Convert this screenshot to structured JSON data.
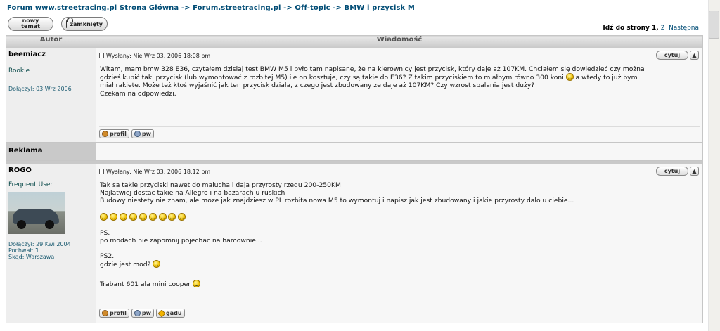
{
  "breadcrumb": "Forum www.streetracing.pl Strona Główna -> Forum.streetracing.pl -> Off-topic -> BMW i przycisk M",
  "buttons": {
    "new_topic_line1": "nowy",
    "new_topic_line2": "temat",
    "locked": "zamknięty"
  },
  "pager": {
    "prefix": "Idź do strony",
    "current": "1",
    "sep": ",",
    "page2": "2",
    "next": "Następna"
  },
  "table": {
    "col_author": "Autor",
    "col_message": "Wiadomość"
  },
  "posts": [
    {
      "author": "beemiacz",
      "rank": "Rookie",
      "joined": "Dołączył: 03 Wrz 2006",
      "posted": "Wysłany: Nie Wrz 03, 2006 18:08 pm",
      "quote": "cytuj",
      "lines": [
        "Witam, mam bmw 328 E36, czytałem dzisiaj test BMW M5 i było tam napisane, że na kierownicy jest przycisk, który daje aż 107KM. Chciałem się dowiedzieć czy można",
        "gdzieś kupić taki przycisk (lub wymontować z rozbitej M5) ile on kosztuje, czy są takie do E36? Z takim przyciskiem to miałbym równo 300 koni",
        "a wtedy to już bym",
        "miał rakiete. Może też ktoś wyjaśnić jak ten przycisk działa, z czego jest zbudowany ze daje aż 107KM? Czy wzrost spalania jest duży?",
        "Czekam na odpowiedzi."
      ],
      "actions": [
        "profil",
        "pw"
      ]
    },
    {
      "author": "ROGO",
      "rank": "Frequent User",
      "joined": "Dołączył: 29 Kwi 2004",
      "praise_label": "Pochwał:",
      "praise": "1",
      "from": "Skąd: Warszawa",
      "posted": "Wysłany: Nie Wrz 03, 2006 18:12 pm",
      "quote": "cytuj",
      "lines": [
        "Tak sa takie przyciski nawet do malucha i daja przyrosty rzedu 200-250KM",
        "Najlatwiej dostac takie na Allegro i na bazarach u ruskich",
        "Budowy niestety nie znam, ale moze jak znajdziesz w PL rozbita nowa M5 to wymontuj i napisz jak jest zbudowany i jakie przyrosty dalo u ciebie...",
        "PS.",
        "po modach nie zapomnij pojechac na hamownie...",
        "PS2.",
        "gdzie jest mod?",
        "Trabant 601 ala mini cooper"
      ],
      "actions": [
        "profil",
        "pw",
        "gadu"
      ]
    }
  ],
  "ad_label": "Reklama"
}
